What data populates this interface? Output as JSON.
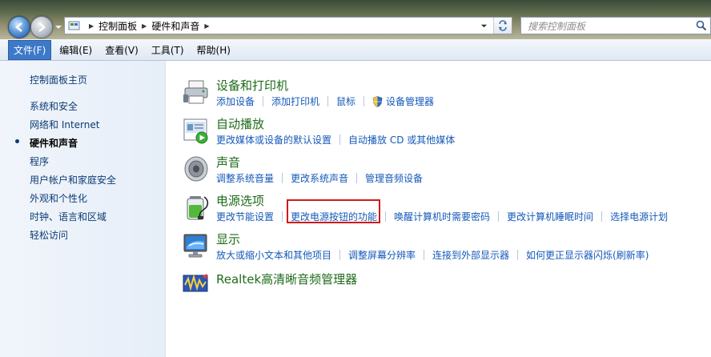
{
  "address": {
    "crumbs": [
      "控制面板",
      "硬件和声音"
    ]
  },
  "search": {
    "placeholder": "搜索控制面板"
  },
  "menu": [
    {
      "label": "文件(F)",
      "active": true
    },
    {
      "label": "编辑(E)"
    },
    {
      "label": "查看(V)"
    },
    {
      "label": "工具(T)"
    },
    {
      "label": "帮助(H)"
    }
  ],
  "sidebar": {
    "home": "控制面板主页",
    "items": [
      "系统和安全",
      "网络和 Internet",
      "硬件和声音",
      "程序",
      "用户帐户和家庭安全",
      "外观和个性化",
      "时钟、语言和区域",
      "轻松访问"
    ],
    "current_index": 2
  },
  "categories": [
    {
      "title": "设备和打印机",
      "icon": "printer-icon",
      "links": [
        "添加设备",
        "添加打印机",
        "鼠标",
        "设备管理器"
      ]
    },
    {
      "title": "自动播放",
      "icon": "autoplay-icon",
      "links": [
        "更改媒体或设备的默认设置",
        "自动播放 CD 或其他媒体"
      ]
    },
    {
      "title": "声音",
      "icon": "speaker-icon",
      "links": [
        "调整系统音量",
        "更改系统声音",
        "管理音频设备"
      ]
    },
    {
      "title": "电源选项",
      "icon": "battery-icon",
      "links": [
        "更改节能设置",
        "更改电源按钮的功能",
        "唤醒计算机时需要密码",
        "更改计算机睡眠时间",
        "选择电源计划"
      ]
    },
    {
      "title": "显示",
      "icon": "monitor-icon",
      "links": [
        "放大或缩小文本和其他项目",
        "调整屏幕分辨率",
        "连接到外部显示器",
        "如何更正显示器闪烁(刷新率)"
      ]
    },
    {
      "title": "Realtek高清晰音频管理器",
      "icon": "realtek-audio-icon",
      "links": []
    }
  ],
  "colors": {
    "link": "#1459b9",
    "title": "#1e6b1a",
    "highlight": "#d11a1a"
  }
}
